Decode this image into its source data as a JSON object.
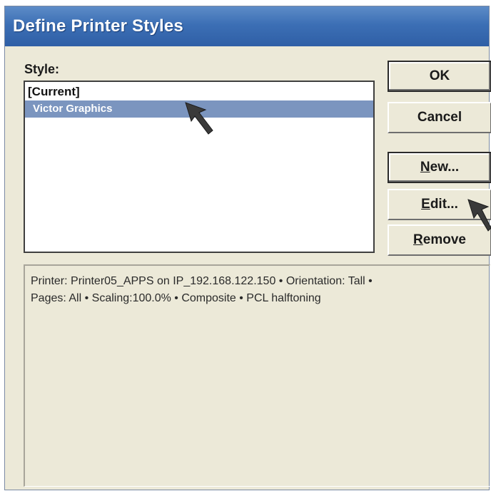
{
  "window": {
    "title": "Define Printer Styles"
  },
  "style_list": {
    "label": "Style:",
    "items": [
      {
        "label": "[Current]",
        "selected": false
      },
      {
        "label": "Victor Graphics",
        "selected": true
      }
    ]
  },
  "buttons": {
    "ok": "OK",
    "cancel": "Cancel",
    "new_mnemonic": "N",
    "new_rest": "ew...",
    "edit_mnemonic": "E",
    "edit_rest": "dit...",
    "remove_mnemonic": "R",
    "remove_rest": "emove"
  },
  "description": {
    "line1": "Printer: Printer05_APPS on IP_192.168.122.150 • Orientation: Tall •",
    "line2": "Pages: All • Scaling:100.0% • Composite • PCL halftoning"
  },
  "colors": {
    "title_bar": "#3c6fb5",
    "selection": "#7b95bf",
    "dialog_bg": "#ece9d8"
  },
  "icons": [
    "mouse-pointer-icon"
  ]
}
